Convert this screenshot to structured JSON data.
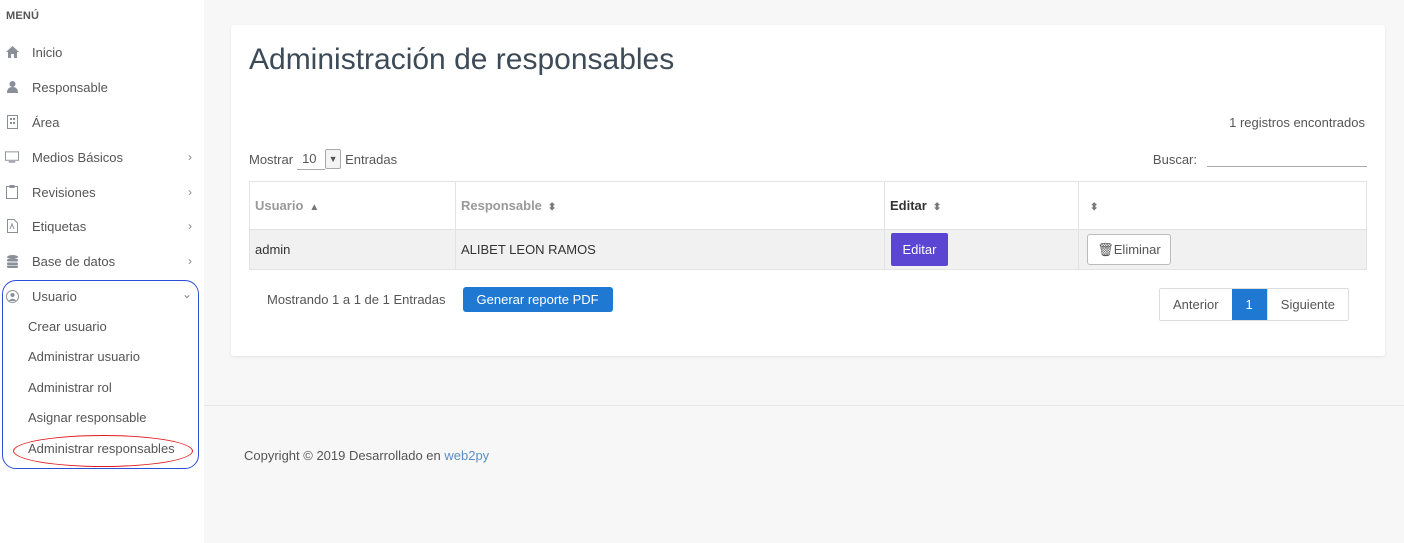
{
  "sidebar": {
    "header": "MENÚ",
    "items": [
      {
        "label": "Inicio",
        "icon": "home-icon"
      },
      {
        "label": "Responsable",
        "icon": "user-icon"
      },
      {
        "label": "Área",
        "icon": "building-icon"
      },
      {
        "label": "Medios Básicos",
        "icon": "monitor-icon",
        "chevron": "right"
      },
      {
        "label": "Revisiones",
        "icon": "clipboard-icon",
        "chevron": "right"
      },
      {
        "label": "Etiquetas",
        "icon": "file-pdf-icon",
        "chevron": "right"
      },
      {
        "label": "Base de datos",
        "icon": "database-icon",
        "chevron": "right"
      },
      {
        "label": "Usuario",
        "icon": "user-circle-icon",
        "chevron": "down"
      }
    ],
    "subitems": [
      "Crear usuario",
      "Administrar usuario",
      "Administrar rol",
      "Asignar responsable",
      "Administrar responsables"
    ]
  },
  "main": {
    "title": "Administración de responsables",
    "records_found": "1 registros encontrados",
    "show_label": "Mostrar",
    "page_size": "10",
    "entries_label": "Entradas",
    "search_label": "Buscar:",
    "search_value": "",
    "columns": [
      "Usuario",
      "Responsable",
      "Editar",
      ""
    ],
    "rows": [
      {
        "usuario": "admin",
        "responsable": "ALIBET LEON RAMOS",
        "edit_label": "Editar",
        "delete_label": "Eliminar"
      }
    ],
    "showing_text": "Mostrando 1 a 1 de 1 Entradas",
    "pdf_button": "Generar reporte PDF",
    "pager": {
      "prev": "Anterior",
      "current": "1",
      "next": "Siguiente"
    }
  },
  "footer": {
    "copyright": "Copyright © 2019 Desarrollado en ",
    "link": "web2py"
  },
  "colors": {
    "accent_blue": "#1f78d1",
    "edit_purple": "#5b45d3",
    "annotation_blue": "#2c4fd8",
    "annotation_red": "#e01b1b"
  }
}
